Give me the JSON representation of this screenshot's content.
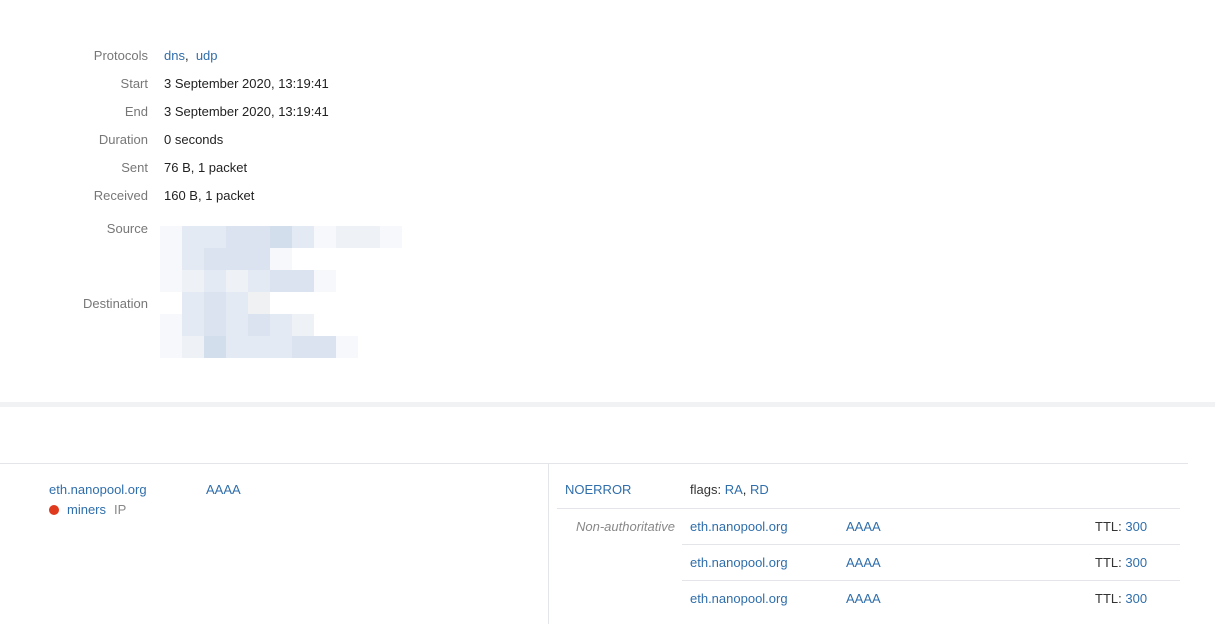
{
  "details": {
    "protocols_label": "Protocols",
    "protocols": [
      "dns",
      "udp"
    ],
    "protocol_separator": ",",
    "start_label": "Start",
    "start": "3 September 2020, 13:19:41",
    "end_label": "End",
    "end": "3 September 2020, 13:19:41",
    "duration_label": "Duration",
    "duration": "0 seconds",
    "sent_label": "Sent",
    "sent": "76 B, 1 packet",
    "received_label": "Received",
    "received": "160 B, 1 packet",
    "source_label": "Source",
    "destination_label": "Destination"
  },
  "dns": {
    "query": {
      "name": "eth.nanopool.org",
      "type": "AAAA",
      "tag_name": "miners",
      "tag_type": "IP",
      "tag_color": "#e03a1e"
    },
    "response": {
      "rcode": "NOERROR",
      "flags_label": "flags:",
      "flags": [
        "RA",
        "RD"
      ],
      "flag_separator": ",",
      "authority": "Non-authoritative",
      "ttl_label": "TTL:",
      "answers": [
        {
          "name": "eth.nanopool.org",
          "type": "AAAA",
          "ttl": "300"
        },
        {
          "name": "eth.nanopool.org",
          "type": "AAAA",
          "ttl": "300"
        },
        {
          "name": "eth.nanopool.org",
          "type": "AAAA",
          "ttl": "300"
        }
      ]
    }
  },
  "colors": {
    "link": "#2f6eab",
    "label": "#777777",
    "divider": "#f1f2f4",
    "border": "#e3e5e8",
    "tag_dot": "#e03a1e"
  }
}
